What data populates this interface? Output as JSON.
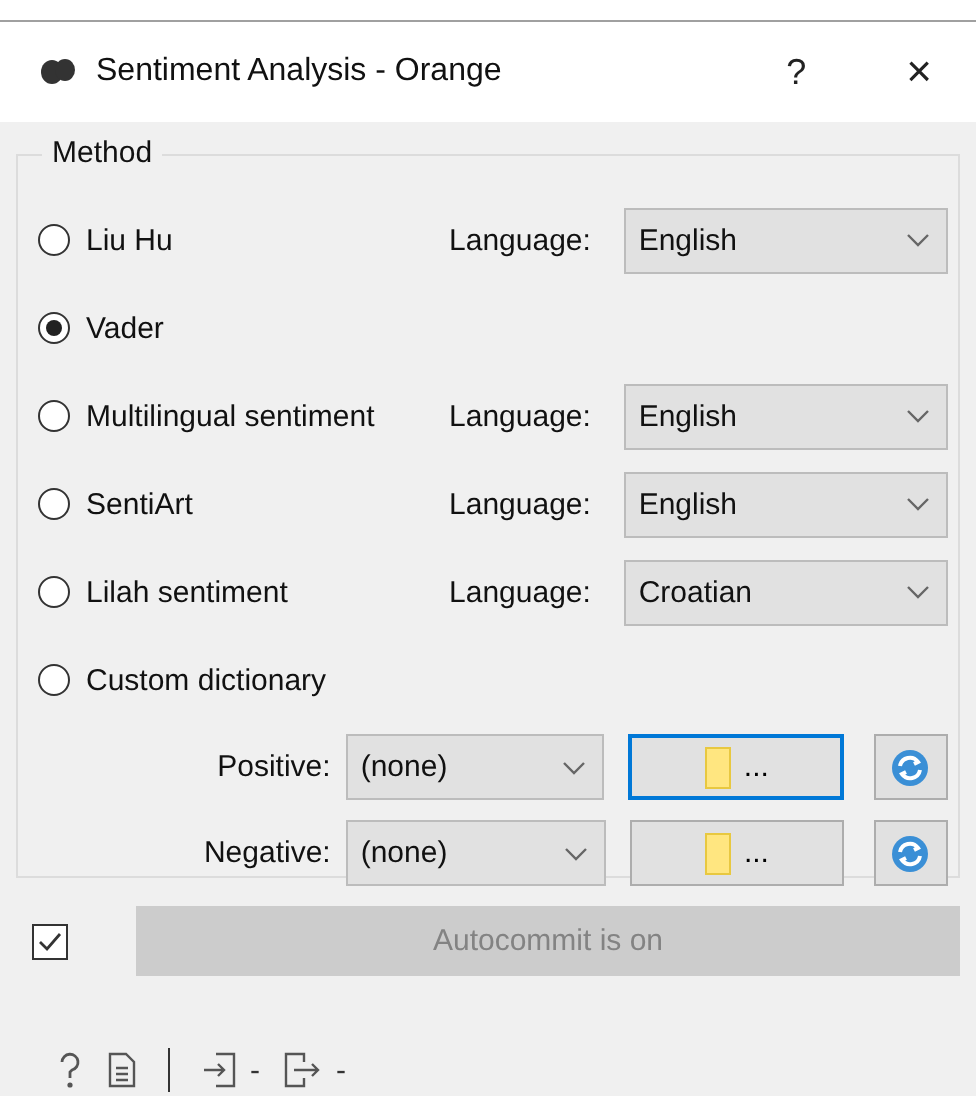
{
  "window": {
    "title": "Sentiment Analysis - Orange",
    "help": "?",
    "close": "×"
  },
  "method": {
    "title": "Method",
    "options": [
      {
        "label": "Liu Hu",
        "selected": false,
        "language_label": "Language:",
        "language": "English"
      },
      {
        "label": "Vader",
        "selected": true
      },
      {
        "label": "Multilingual sentiment",
        "selected": false,
        "language_label": "Language:",
        "language": "English"
      },
      {
        "label": "SentiArt",
        "selected": false,
        "language_label": "Language:",
        "language": "English"
      },
      {
        "label": "Lilah sentiment",
        "selected": false,
        "language_label": "Language:",
        "language": "Croatian"
      },
      {
        "label": "Custom dictionary",
        "selected": false
      }
    ]
  },
  "dictionaries": [
    {
      "label": "Positive:",
      "value": "(none)",
      "browse": "...",
      "focused": true
    },
    {
      "label": "Negative:",
      "value": "(none)",
      "browse": "...",
      "focused": false
    }
  ],
  "autocommit": {
    "checked": true,
    "label": "Autocommit is on"
  },
  "status_bar": {
    "input": "-",
    "output": "-"
  }
}
